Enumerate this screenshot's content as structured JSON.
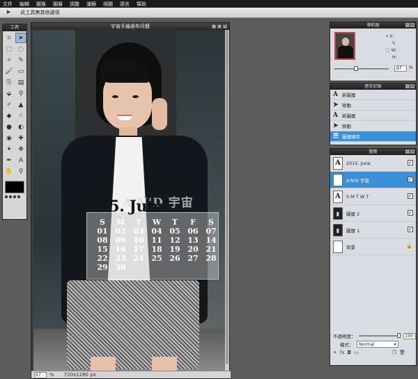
{
  "menubar": {
    "items": [
      "文件",
      "編輯",
      "圖像",
      "圖層",
      "調整",
      "濾鏡",
      "視圖",
      "語言",
      "幫助"
    ]
  },
  "options": {
    "tool_icon": "move-icon",
    "hint": "此工具無其他選項"
  },
  "toolbox": {
    "title": "工具",
    "tools": [
      {
        "icon": "crop-icon",
        "glyph": "⌗"
      },
      {
        "icon": "move-icon",
        "glyph": "➤"
      },
      {
        "icon": "marquee-icon",
        "glyph": "⬚"
      },
      {
        "icon": "lasso-icon",
        "glyph": "◌"
      },
      {
        "icon": "wand-icon",
        "glyph": "✧"
      },
      {
        "icon": "pencil-icon",
        "glyph": "✎"
      },
      {
        "icon": "brush-icon",
        "glyph": "🖌"
      },
      {
        "icon": "eraser-icon",
        "glyph": "▭"
      },
      {
        "icon": "clone-icon",
        "glyph": "⎘"
      },
      {
        "icon": "gradient-icon",
        "glyph": "▤"
      },
      {
        "icon": "bucket-icon",
        "glyph": "⬙"
      },
      {
        "icon": "stamp-icon",
        "glyph": "⚲"
      },
      {
        "icon": "dropper-icon",
        "glyph": "⌿"
      },
      {
        "icon": "blur-icon",
        "glyph": "▲"
      },
      {
        "icon": "sharpen-icon",
        "glyph": "◆"
      },
      {
        "icon": "smudge-icon",
        "glyph": "☝"
      },
      {
        "icon": "sponge-icon",
        "glyph": "●"
      },
      {
        "icon": "dodge-icon",
        "glyph": "◐"
      },
      {
        "icon": "redeye-icon",
        "glyph": "◉"
      },
      {
        "icon": "spot-icon",
        "glyph": "✚"
      },
      {
        "icon": "bloat-icon",
        "glyph": "✦"
      },
      {
        "icon": "pinch-icon",
        "glyph": "✥"
      },
      {
        "icon": "colorpicker-icon",
        "glyph": "✒"
      },
      {
        "icon": "text-icon",
        "glyph": "A"
      },
      {
        "icon": "hand-icon",
        "glyph": "✋"
      },
      {
        "icon": "zoom-icon",
        "glyph": "⚲"
      }
    ]
  },
  "document": {
    "title": "宇宙手繪桌布月曆",
    "zoom": "67",
    "zoom_unit": "%",
    "size": "720x1280 px"
  },
  "calendar": {
    "brand": "A'N'D 宇宙",
    "month": "2015. June",
    "headers": [
      "S",
      "M",
      "T",
      "W",
      "T",
      "F",
      "S"
    ],
    "days": [
      "01",
      "02",
      "03",
      "04",
      "05",
      "06",
      "07",
      "08",
      "09",
      "10",
      "11",
      "12",
      "13",
      "14",
      "15",
      "16",
      "17",
      "18",
      "19",
      "20",
      "21",
      "22",
      "23",
      "24",
      "25",
      "26",
      "27",
      "28",
      "29",
      "30"
    ]
  },
  "navigator": {
    "title": "導航器",
    "x_label": "X:",
    "y_label": "Y:",
    "w_label": "W:",
    "h_label": "H:",
    "zoom": "67",
    "zoom_unit": "%"
  },
  "history": {
    "title": "歷史記錄",
    "items": [
      {
        "icon": "text-icon",
        "glyph": "A",
        "label": "新圖層"
      },
      {
        "icon": "move-icon",
        "glyph": "➤",
        "label": "移動"
      },
      {
        "icon": "text-icon",
        "glyph": "A",
        "label": "新圖層"
      },
      {
        "icon": "move-icon",
        "glyph": "➤",
        "label": "移動"
      },
      {
        "icon": "layer-order-icon",
        "glyph": "☰",
        "label": "圖層順序"
      }
    ]
  },
  "layers": {
    "title": "圖層",
    "items": [
      {
        "thumb": "A",
        "label": "2015. June"
      },
      {
        "thumb": "A",
        "label": "A'N'D 宇宙"
      },
      {
        "thumb": "A",
        "label": "S      M      T      W      T"
      },
      {
        "thumb": "▮",
        "label": "圖層 2"
      },
      {
        "thumb": "▮",
        "label": "圖層 1"
      },
      {
        "thumb": "",
        "label": "背景"
      }
    ],
    "opacity_label": "不透明度：",
    "opacity": "100",
    "mode_label": "模式：",
    "mode": "Normal"
  }
}
